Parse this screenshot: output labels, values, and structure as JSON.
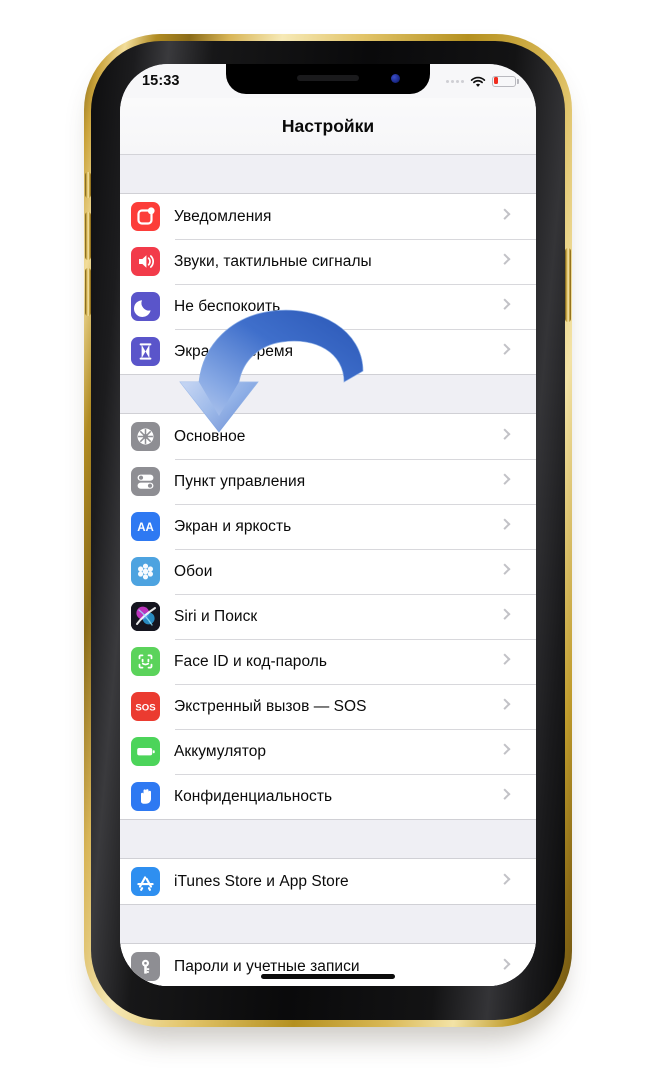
{
  "device": {
    "frame_color": "#d9b855",
    "bezel_color": "#101012"
  },
  "status_bar": {
    "time": "15:33",
    "wifi_icon": "wifi-icon",
    "battery_icon": "battery-low-icon",
    "signal_dots_icon": "signal-dots-icon",
    "battery_color": "#f02b1d"
  },
  "navbar": {
    "title": "Настройки"
  },
  "groups": [
    {
      "rows": [
        {
          "label": "Уведомления",
          "icon": "notifications-icon",
          "color": "#fc3d39"
        },
        {
          "label": "Звуки, тактильные сигналы",
          "icon": "sounds-icon",
          "color": "#f23b4a"
        },
        {
          "label": "Не беспокоить",
          "icon": "do-not-disturb-icon",
          "color": "#5a55ca"
        },
        {
          "label": "Экранное время",
          "icon": "screen-time-icon",
          "color": "#5a55ca"
        }
      ]
    },
    {
      "rows": [
        {
          "label": "Основное",
          "icon": "general-gear-icon",
          "color": "#8e8e93"
        },
        {
          "label": "Пункт управления",
          "icon": "control-center-icon",
          "color": "#8e8e93"
        },
        {
          "label": "Экран и яркость",
          "icon": "display-brightness-icon",
          "color": "#2e79f2"
        },
        {
          "label": "Обои",
          "icon": "wallpaper-icon",
          "color": "#4da3e0"
        },
        {
          "label": "Siri и Поиск",
          "icon": "siri-icon",
          "color": "#141422"
        },
        {
          "label": "Face ID и код-пароль",
          "icon": "face-id-icon",
          "color": "#5bd35b"
        },
        {
          "label": "Экстренный вызов — SOS",
          "icon": "sos-icon",
          "color": "#eb3b30"
        },
        {
          "label": "Аккумулятор",
          "icon": "battery-settings-icon",
          "color": "#4cd45a"
        },
        {
          "label": "Конфиденциальность",
          "icon": "privacy-hand-icon",
          "color": "#2e79f2"
        }
      ]
    },
    {
      "rows": [
        {
          "label": "iTunes Store и App Store",
          "icon": "app-store-icon",
          "color": "#2e8ff0"
        }
      ]
    },
    {
      "rows": [
        {
          "label": "Пароли и учетные записи",
          "icon": "passwords-key-icon",
          "color": "#8e8e93"
        }
      ]
    }
  ],
  "annotation": {
    "arrow_icon": "curved-down-arrow-icon",
    "arrow_color_light": "#a8c4ee",
    "arrow_color_dark": "#2f5fc0",
    "points_at": "Пункт управления"
  },
  "home_indicator": "home-indicator"
}
